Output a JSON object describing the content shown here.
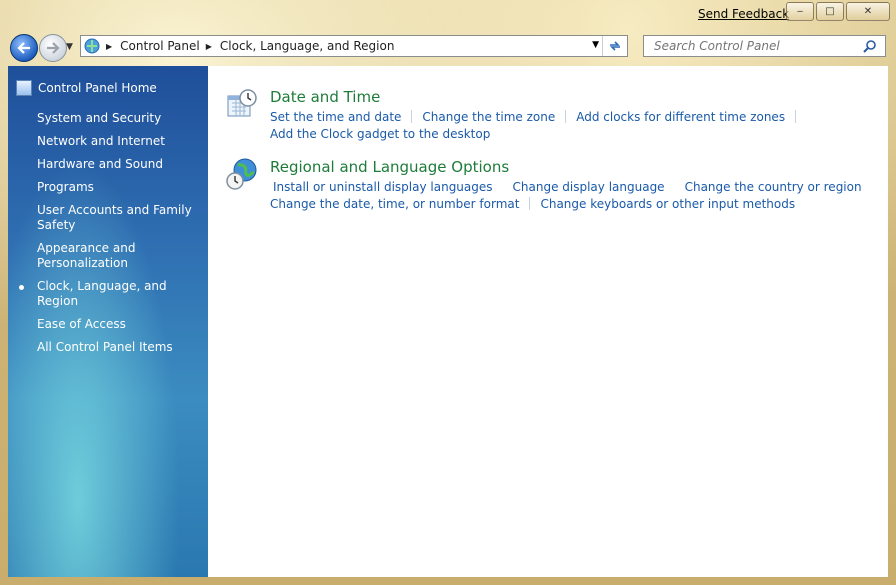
{
  "titlebar": {
    "feedback_label": "Send Feedback",
    "minimize_label": "‒",
    "maximize_label": "□",
    "close_label": "✕"
  },
  "navigation": {
    "breadcrumbs": [
      "Control Panel",
      "Clock, Language, and Region"
    ],
    "search_placeholder": "Search Control Panel"
  },
  "sidebar": {
    "home_label": "Control Panel Home",
    "items": [
      {
        "label": "System and Security",
        "current": false
      },
      {
        "label": "Network and Internet",
        "current": false
      },
      {
        "label": "Hardware and Sound",
        "current": false
      },
      {
        "label": "Programs",
        "current": false
      },
      {
        "label": "User Accounts and Family Safety",
        "current": false
      },
      {
        "label": "Appearance and Personalization",
        "current": false
      },
      {
        "label": "Clock, Language, and Region",
        "current": true
      },
      {
        "label": "Ease of Access",
        "current": false
      },
      {
        "label": "All Control Panel Items",
        "current": false
      }
    ]
  },
  "sections": [
    {
      "title": "Date and Time",
      "icon": "calendar-clock-icon",
      "rows": [
        [
          "Set the time and date",
          "Change the time zone",
          "Add clocks for different time zones"
        ],
        [
          "Add the Clock gadget to the desktop"
        ]
      ]
    },
    {
      "title": "Regional and Language Options",
      "icon": "globe-clock-icon",
      "rows": [
        [
          "Install or uninstall display languages",
          "Change display language",
          "Change the country or region"
        ],
        [
          "Change the date, time, or number format",
          "Change keyboards or other input methods"
        ]
      ]
    }
  ],
  "colors": {
    "link": "#1a5aa8",
    "section_title": "#1e7c3a",
    "sidebar_top": "#1f4f9a",
    "sidebar_bottom": "#2a78b0"
  }
}
